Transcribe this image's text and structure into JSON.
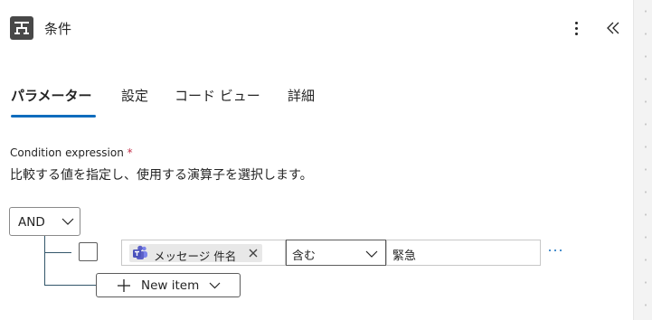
{
  "header": {
    "title": "条件",
    "app_icon": "condition-icon",
    "more_icon": "more-vertical-icon",
    "collapse_icon": "double-chevron-left-icon"
  },
  "tabs": [
    {
      "label": "パラメーター",
      "active": true
    },
    {
      "label": "設定",
      "active": false
    },
    {
      "label": "コード ビュー",
      "active": false
    },
    {
      "label": "詳細",
      "active": false
    }
  ],
  "condition": {
    "label": "Condition expression",
    "required_mark": "*",
    "description": "比較する値を指定し、使用する演算子を選択します。",
    "group_operator": "AND",
    "rows": [
      {
        "checked": false,
        "left_operand": {
          "token_label": "メッセージ 件名",
          "token_icon": "teams-icon"
        },
        "operator": "含む",
        "right_operand": "緊急"
      }
    ],
    "new_item_label": "New item"
  },
  "colors": {
    "accent": "#0f6cbd",
    "app_icon_bg": "#484848",
    "teams_purple": "#5b5fc7",
    "tree_line": "#33566a",
    "required": "#c4314b"
  }
}
